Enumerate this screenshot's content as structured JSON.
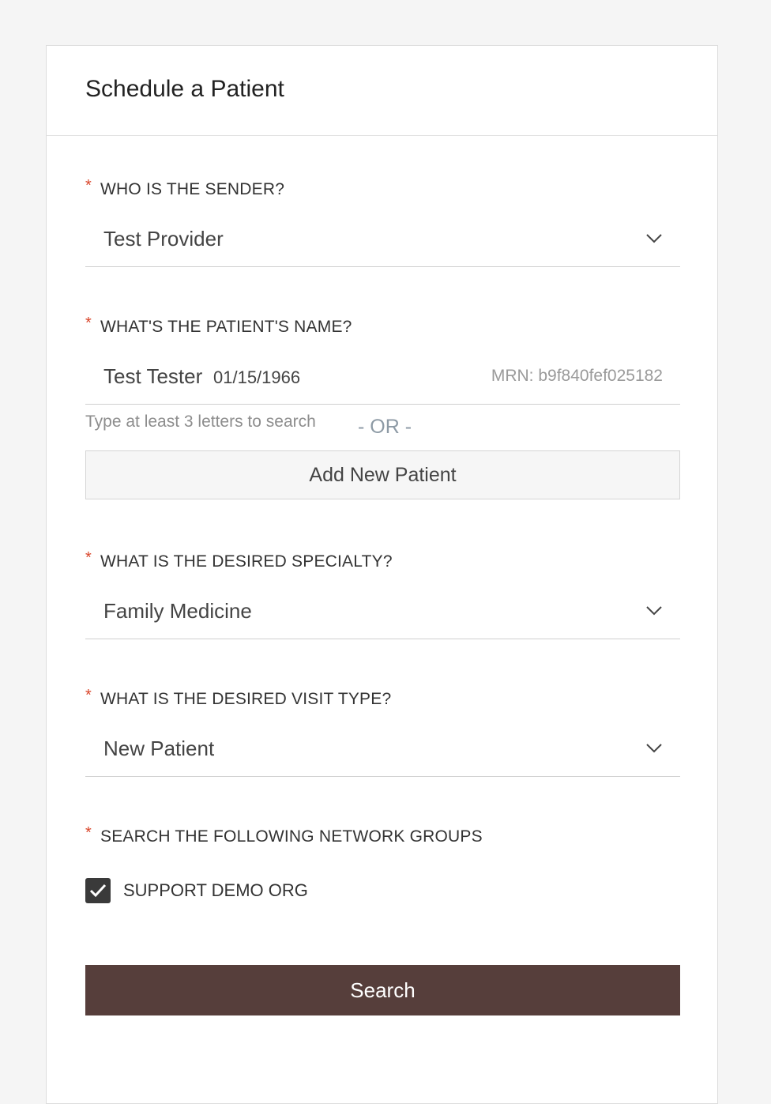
{
  "card": {
    "title": "Schedule a Patient"
  },
  "required_marker": "*",
  "sender": {
    "label": "WHO IS THE SENDER?",
    "value": "Test Provider"
  },
  "patient": {
    "label": "WHAT'S THE PATIENT'S NAME?",
    "name": "Test Tester",
    "dob": "01/15/1966",
    "mrn": "MRN: b9f840fef025182",
    "hint": "Type at least 3 letters to search",
    "or_text": "- OR -",
    "add_label": "Add New Patient"
  },
  "specialty": {
    "label": "WHAT IS THE DESIRED SPECIALTY?",
    "value": "Family Medicine"
  },
  "visit_type": {
    "label": "WHAT IS THE DESIRED VISIT TYPE?",
    "value": "New Patient"
  },
  "network_groups": {
    "label": "SEARCH THE FOLLOWING NETWORK GROUPS",
    "items": [
      {
        "label": "SUPPORT DEMO ORG",
        "checked": true
      }
    ]
  },
  "search_label": "Search",
  "icons": {
    "dropdown": "chevron-down-icon",
    "check": "check-icon"
  },
  "colors": {
    "required": "#d9462b",
    "primary_button": "#563e3b",
    "checkbox": "#3a3a3a"
  }
}
